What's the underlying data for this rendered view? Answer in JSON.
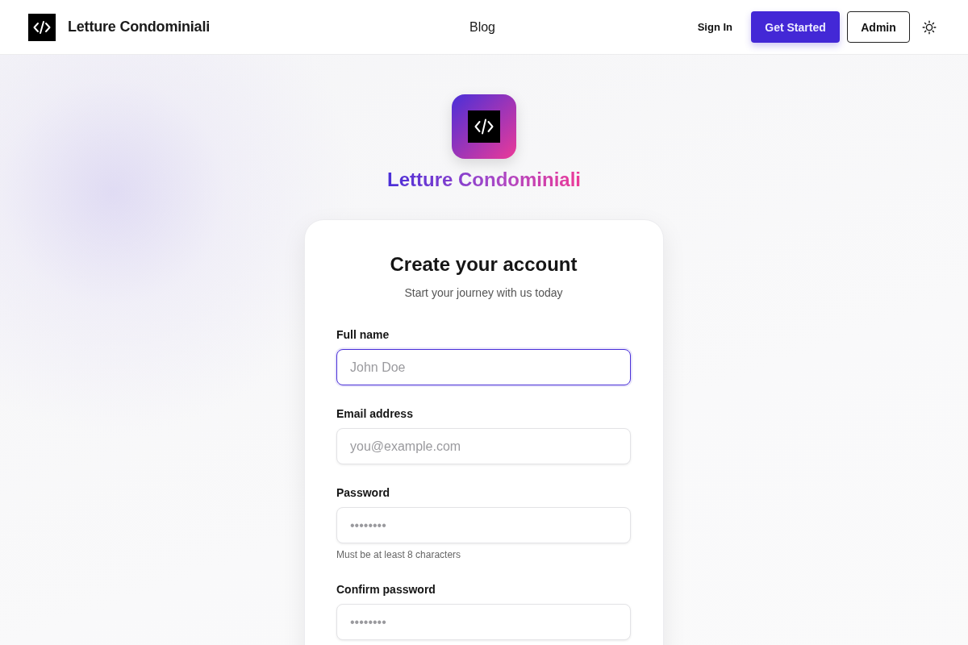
{
  "header": {
    "brand": "Letture Condominiali",
    "nav": [
      {
        "label": "Blog"
      }
    ],
    "actions": [
      {
        "kind": "link",
        "label": "Sign In"
      },
      {
        "kind": "primary",
        "label": "Get Started"
      },
      {
        "kind": "outline",
        "label": "Admin"
      }
    ]
  },
  "hero": {
    "brand": "Letture Condominiali"
  },
  "form": {
    "title": "Create your account",
    "subtitle": "Start your journey with us today",
    "fields": [
      {
        "label": "Full name",
        "placeholder": "John Doe",
        "focused": true
      },
      {
        "label": "Email address",
        "placeholder": "you@example.com",
        "focused": false
      },
      {
        "label": "Password",
        "placeholder": "••••••••",
        "focused": false,
        "hint": "Must be at least 8 characters"
      },
      {
        "label": "Confirm password",
        "placeholder": "••••••••",
        "focused": false
      }
    ]
  }
}
